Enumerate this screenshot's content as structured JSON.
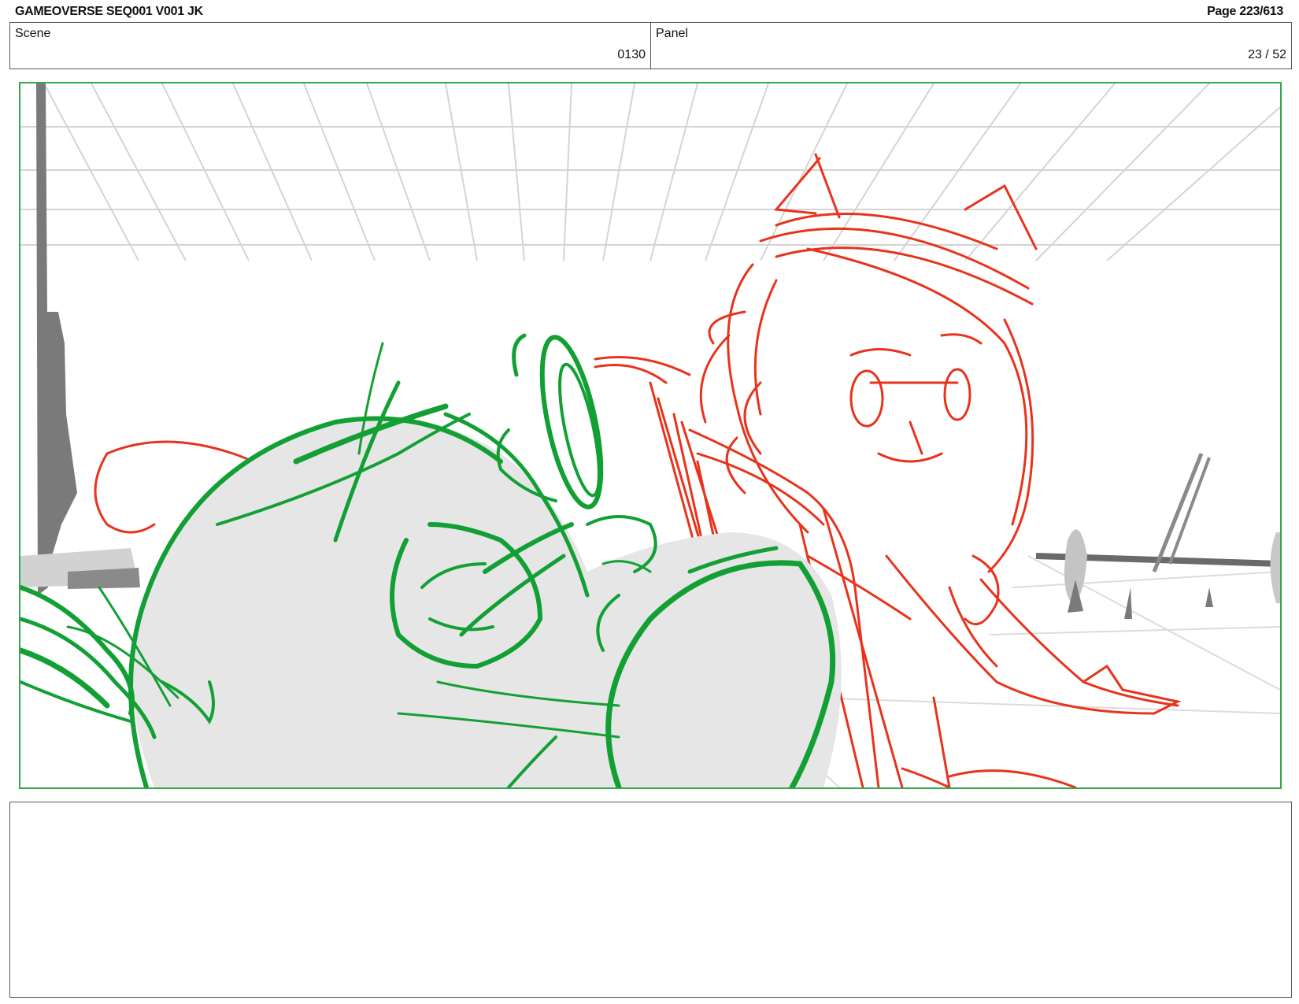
{
  "header": {
    "doc_title": "GAMEOVERSE SEQ001 V001 JK",
    "page": "Page 223/613"
  },
  "info": {
    "scene_label": "Scene",
    "scene_value": "0130",
    "panel_label": "Panel",
    "panel_value": "23 / 52"
  },
  "panel": {
    "colors": {
      "frame": "#33a84a",
      "character_green": "#12a034",
      "character_red": "#e8331c",
      "fill_gray": "#e6e6e6",
      "bg_dark": "#7a7a7a",
      "bg_light": "#d2d2d2"
    }
  },
  "notes": {
    "text": ""
  }
}
